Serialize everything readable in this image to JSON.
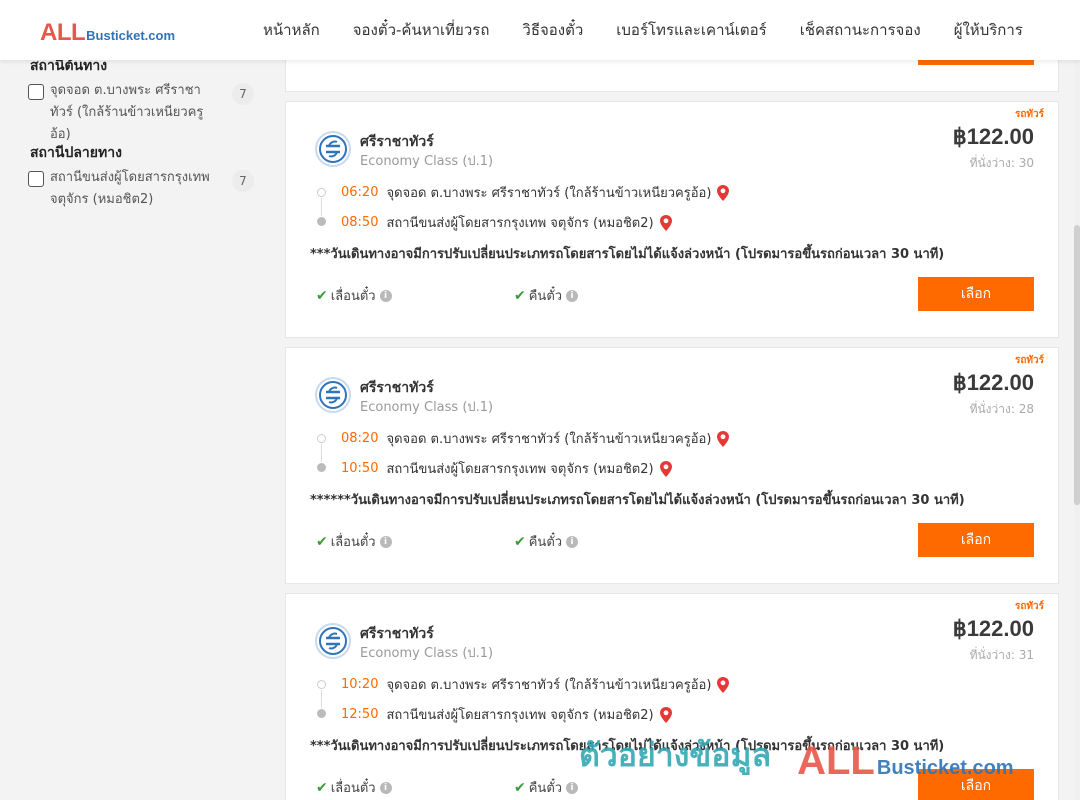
{
  "header": {
    "logo_all": "ALL",
    "logo_rest": "Busticket.com",
    "nav": [
      "หน้าหลัก",
      "จองตั๋ว-ค้นหาเที่ยวรถ",
      "วิธีจองตั๋ว",
      "เบอร์โทรและเคาน์เตอร์",
      "เช็คสถานะการจอง",
      "ผู้ให้บริการ"
    ]
  },
  "sidebar": {
    "origin_heading": "สถานีต้นทาง",
    "origin_items": [
      {
        "label": "จุดจอด ต.บางพระ ศรีราชาทัวร์ (ใกล้ร้านข้าวเหนียวครูอ้อ)",
        "count": "7"
      }
    ],
    "destination_heading": "สถานีปลายทาง",
    "destination_items": [
      {
        "label": "สถานีขนส่งผู้โดยสารกรุงเทพ จตุจักร (หมอชิต2)",
        "count": "7"
      }
    ]
  },
  "trips": [
    {
      "bus_type": "รถทัวร์",
      "operator": "ศรีราชาทัวร์",
      "bus_class": "Economy Class (ป.1)",
      "price": "฿122.00",
      "seats": "ที่นั่งว่าง: 30",
      "depart_time": "06:20",
      "depart_place": "จุดจอด ต.บางพระ ศรีราชาทัวร์ (ใกล้ร้านข้าวเหนียวครูอ้อ)",
      "arrive_time": "08:50",
      "arrive_place": "สถานีขนส่งผู้โดยสารกรุงเทพ จตุจักร (หมอชิต2)",
      "note": "***วันเดินทางอาจมีการปรับเปลี่ยนประเภทรถโดยสารโดยไม่ได้แจ้งล่วงหน้า (โปรดมารอขึ้นรถก่อนเวลา 30 นาที)",
      "feature_1": "เลื่อนตั๋ว",
      "feature_2": "คืนตั๋ว",
      "select_label": "เลือก"
    },
    {
      "bus_type": "รถทัวร์",
      "operator": "ศรีราชาทัวร์",
      "bus_class": "Economy Class (ป.1)",
      "price": "฿122.00",
      "seats": "ที่นั่งว่าง: 28",
      "depart_time": "08:20",
      "depart_place": "จุดจอด ต.บางพระ ศรีราชาทัวร์ (ใกล้ร้านข้าวเหนียวครูอ้อ)",
      "arrive_time": "10:50",
      "arrive_place": "สถานีขนส่งผู้โดยสารกรุงเทพ จตุจักร (หมอชิต2)",
      "note": "******วันเดินทางอาจมีการปรับเปลี่ยนประเภทรถโดยสารโดยไม่ได้แจ้งล่วงหน้า (โปรดมารอขึ้นรถก่อนเวลา 30 นาที)",
      "feature_1": "เลื่อนตั๋ว",
      "feature_2": "คืนตั๋ว",
      "select_label": "เลือก"
    },
    {
      "bus_type": "รถทัวร์",
      "operator": "ศรีราชาทัวร์",
      "bus_class": "Economy Class (ป.1)",
      "price": "฿122.00",
      "seats": "ที่นั่งว่าง: 31",
      "depart_time": "10:20",
      "depart_place": "จุดจอด ต.บางพระ ศรีราชาทัวร์ (ใกล้ร้านข้าวเหนียวครูอ้อ)",
      "arrive_time": "12:50",
      "arrive_place": "สถานีขนส่งผู้โดยสารกรุงเทพ จตุจักร (หมอชิต2)",
      "note": "***วันเดินทางอาจมีการปรับเปลี่ยนประเภทรถโดยสารโดยไม่ได้แจ้งล่วงหน้า (โปรดมารอขึ้นรถก่อนเวลา 30 นาที)",
      "feature_1": "เลื่อนตั๋ว",
      "feature_2": "คืนตั๋ว",
      "select_label": "เลือก"
    }
  ],
  "watermark": {
    "text": "ตัวอย่างข้อมูล",
    "logo_all": "ALL",
    "logo_rest": "Busticket.com"
  },
  "colors": {
    "accent": "#ff6a00",
    "logo_red": "#e8584a",
    "logo_blue": "#2f73b8",
    "check_green": "#3a9b3a",
    "watermark_teal": "#35a8b4"
  }
}
